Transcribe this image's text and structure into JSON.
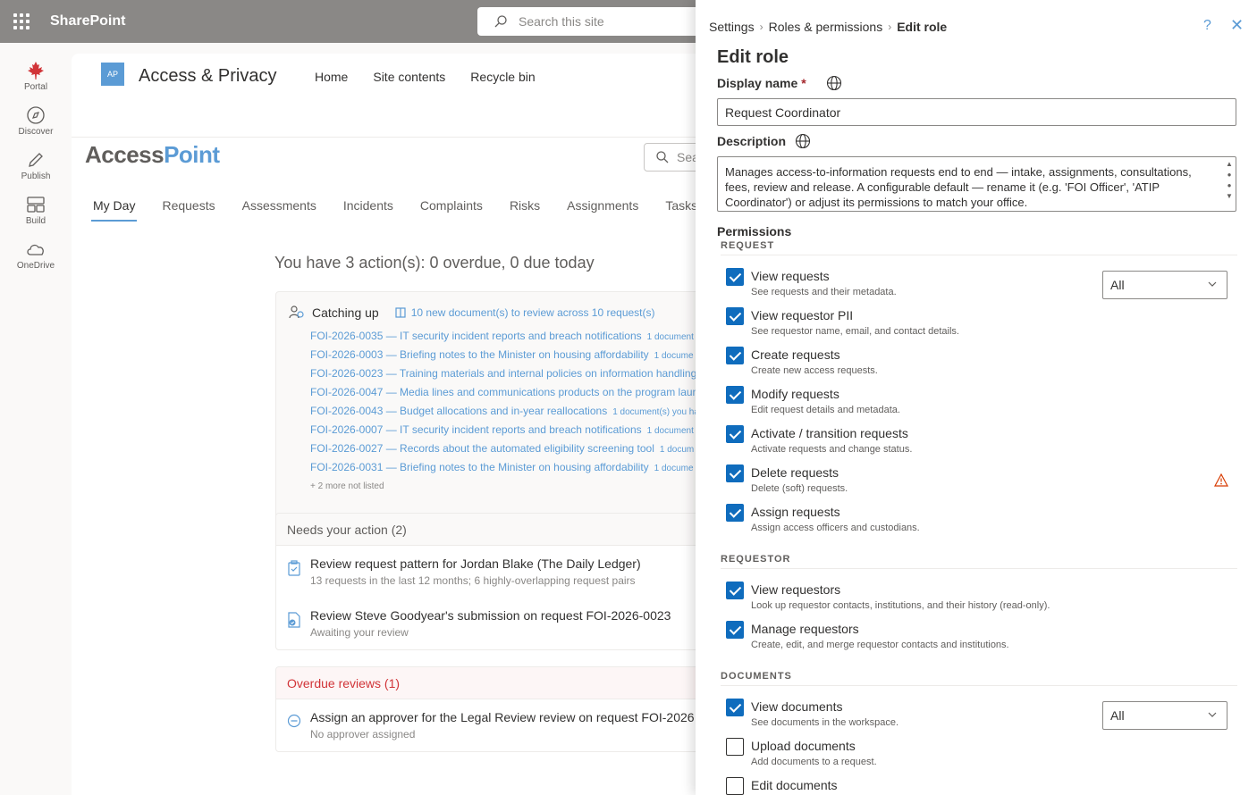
{
  "suite": {
    "brand": "SharePoint",
    "search_placeholder": "Search this site"
  },
  "appbar": {
    "items": [
      {
        "label": "Portal",
        "icon": "maple-leaf-icon"
      },
      {
        "label": "Discover",
        "icon": "compass-icon"
      },
      {
        "label": "Publish",
        "icon": "pen-icon"
      },
      {
        "label": "Build",
        "icon": "build-icon"
      },
      {
        "label": "OneDrive",
        "icon": "cloud-icon"
      }
    ]
  },
  "site": {
    "logo_text": "AP",
    "title": "Access & Privacy",
    "nav": [
      "Home",
      "Site contents",
      "Recycle bin"
    ]
  },
  "app": {
    "logo_part1": "Access",
    "logo_part2": "Point",
    "search_placeholder": "Sea",
    "tabs": [
      "My Day",
      "Requests",
      "Assessments",
      "Incidents",
      "Complaints",
      "Risks",
      "Assignments",
      "Tasks"
    ],
    "active_tab": "My Day"
  },
  "myday": {
    "summary": "You have 3 action(s): 0 overdue, 0 due today",
    "catching_up": {
      "title": "Catching up",
      "link": "10 new document(s) to review across 10 request(s)",
      "rows": [
        {
          "text": "FOI-2026-0035 — IT security incident reports and breach notifications",
          "count": "1 document"
        },
        {
          "text": "FOI-2026-0003 — Briefing notes to the Minister on housing affordability",
          "count": "1 docume"
        },
        {
          "text": "FOI-2026-0023 — Training materials and internal policies on information handling",
          "count": ""
        },
        {
          "text": "FOI-2026-0047 — Media lines and communications products on the program laun",
          "count": ""
        },
        {
          "text": "FOI-2026-0043 — Budget allocations and in-year reallocations",
          "count": "1 document(s) you ha"
        },
        {
          "text": "FOI-2026-0007 — IT security incident reports and breach notifications",
          "count": "1 document"
        },
        {
          "text": "FOI-2026-0027 — Records about the automated eligibility screening tool",
          "count": "1 docum"
        },
        {
          "text": "FOI-2026-0031 — Briefing notes to the Minister on housing affordability",
          "count": "1 docume"
        }
      ],
      "more": "+ 2 more not listed"
    },
    "needs_action": {
      "title": "Needs your action (2)",
      "items": [
        {
          "title": "Review request pattern for Jordan Blake (The Daily Ledger)",
          "sub": "13 requests in the last 12 months; 6 highly-overlapping request pairs"
        },
        {
          "title": "Review Steve Goodyear's submission on request FOI-2026-0023",
          "sub": "Awaiting your review"
        }
      ]
    },
    "overdue": {
      "title": "Overdue reviews (1)",
      "items": [
        {
          "title": "Assign an approver for the Legal Review review on request FOI-2026",
          "sub": "No approver assigned"
        }
      ]
    }
  },
  "panel": {
    "breadcrumb": [
      "Settings",
      "Roles & permissions",
      "Edit role"
    ],
    "title": "Edit role",
    "display_name_label": "Display name",
    "required_mark": "*",
    "display_name_value": "Request Coordinator",
    "description_label": "Description",
    "description_value": "Manages access-to-information requests end to end — intake, assignments, consultations, fees, review and release. A configurable default — rename it (e.g. 'FOI Officer', 'ATIP Coordinator') or adjust its permissions to match your office.",
    "permissions_label": "Permissions",
    "sections": {
      "request": "REQUEST",
      "requestor": "REQUESTOR",
      "documents": "DOCUMENTS"
    },
    "request_perms": [
      {
        "name": "View requests",
        "desc": "See requests and their metadata.",
        "checked": true,
        "scope": "All"
      },
      {
        "name": "View requestor PII",
        "desc": "See requestor name, email, and contact details.",
        "checked": true
      },
      {
        "name": "Create requests",
        "desc": "Create new access requests.",
        "checked": true
      },
      {
        "name": "Modify requests",
        "desc": "Edit request details and metadata.",
        "checked": true
      },
      {
        "name": "Activate / transition requests",
        "desc": "Activate requests and change status.",
        "checked": true
      },
      {
        "name": "Delete requests",
        "desc": "Delete (soft) requests.",
        "checked": true,
        "warning": true
      },
      {
        "name": "Assign requests",
        "desc": "Assign access officers and custodians.",
        "checked": true
      }
    ],
    "requestor_perms": [
      {
        "name": "View requestors",
        "desc": "Look up requestor contacts, institutions, and their history (read-only).",
        "checked": true
      },
      {
        "name": "Manage requestors",
        "desc": "Create, edit, and merge requestor contacts and institutions.",
        "checked": true
      }
    ],
    "document_perms": [
      {
        "name": "View documents",
        "desc": "See documents in the workspace.",
        "checked": true,
        "scope": "All"
      },
      {
        "name": "Upload documents",
        "desc": "Add documents to a request.",
        "checked": false
      },
      {
        "name": "Edit documents",
        "desc": "",
        "checked": false
      }
    ]
  },
  "colors": {
    "accent": "#0f6cbd",
    "link": "#5b9bd5",
    "warning": "#d83b01",
    "overdue": "#d13438"
  }
}
